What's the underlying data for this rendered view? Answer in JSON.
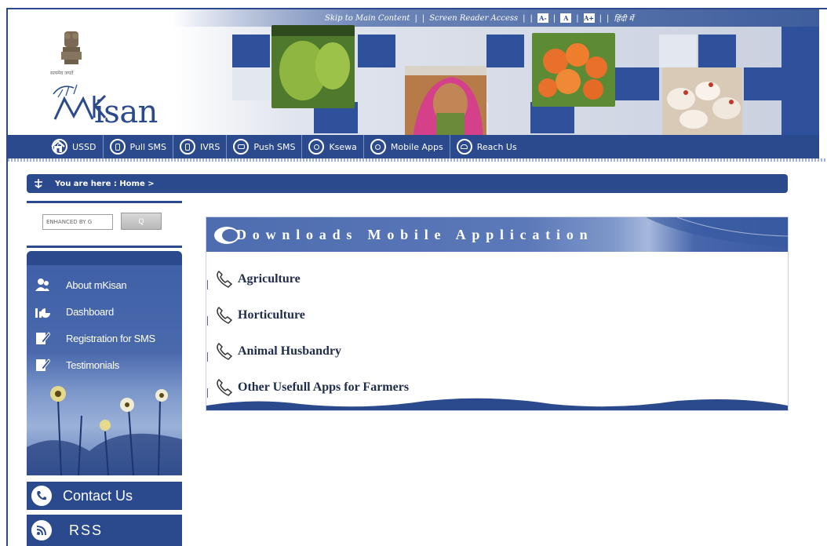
{
  "topbar": {
    "skip": "Skip to Main Content",
    "screen_reader": "Screen Reader Access",
    "font_decrease": "A-",
    "font_normal": "A",
    "font_increase": "A+",
    "hindi": "हिंदी में"
  },
  "brand": {
    "emblem_caption": "सत्यमेव जयते",
    "logo_text": "isan"
  },
  "nav": {
    "items": [
      {
        "label": "USSD",
        "icon": "mobile-icon"
      },
      {
        "label": "Pull SMS",
        "icon": "mobile-icon"
      },
      {
        "label": "IVRS",
        "icon": "phone-wave-icon"
      },
      {
        "label": "Push SMS",
        "icon": "sms-bubble-icon"
      },
      {
        "label": "Ksewa",
        "icon": "person-icon"
      },
      {
        "label": "Mobile Apps",
        "icon": "person-icon"
      },
      {
        "label": "Reach Us",
        "icon": "telephone-icon"
      }
    ]
  },
  "breadcrumb": {
    "text": "You are here : Home >"
  },
  "search": {
    "placeholder": "ENHANCED BY G",
    "button_label": "Q"
  },
  "sidebar": {
    "items": [
      {
        "label": "About mKisan",
        "icon": "users-icon"
      },
      {
        "label": "Dashboard",
        "icon": "chart-icon"
      },
      {
        "label": "Registration for SMS",
        "icon": "edit-icon"
      },
      {
        "label": "Testimonials",
        "icon": "edit-icon"
      }
    ],
    "contact_label": "Contact Us",
    "rss_label": "RSS"
  },
  "downloads": {
    "title": "Downloads Mobile Application",
    "items": [
      {
        "label": "Agriculture"
      },
      {
        "label": "Horticulture"
      },
      {
        "label": "Animal Husbandry"
      },
      {
        "label": "Other Usefull Apps for Farmers"
      }
    ]
  },
  "colors": {
    "primary": "#2b4a8e",
    "text_dark": "#1f2d4a"
  }
}
